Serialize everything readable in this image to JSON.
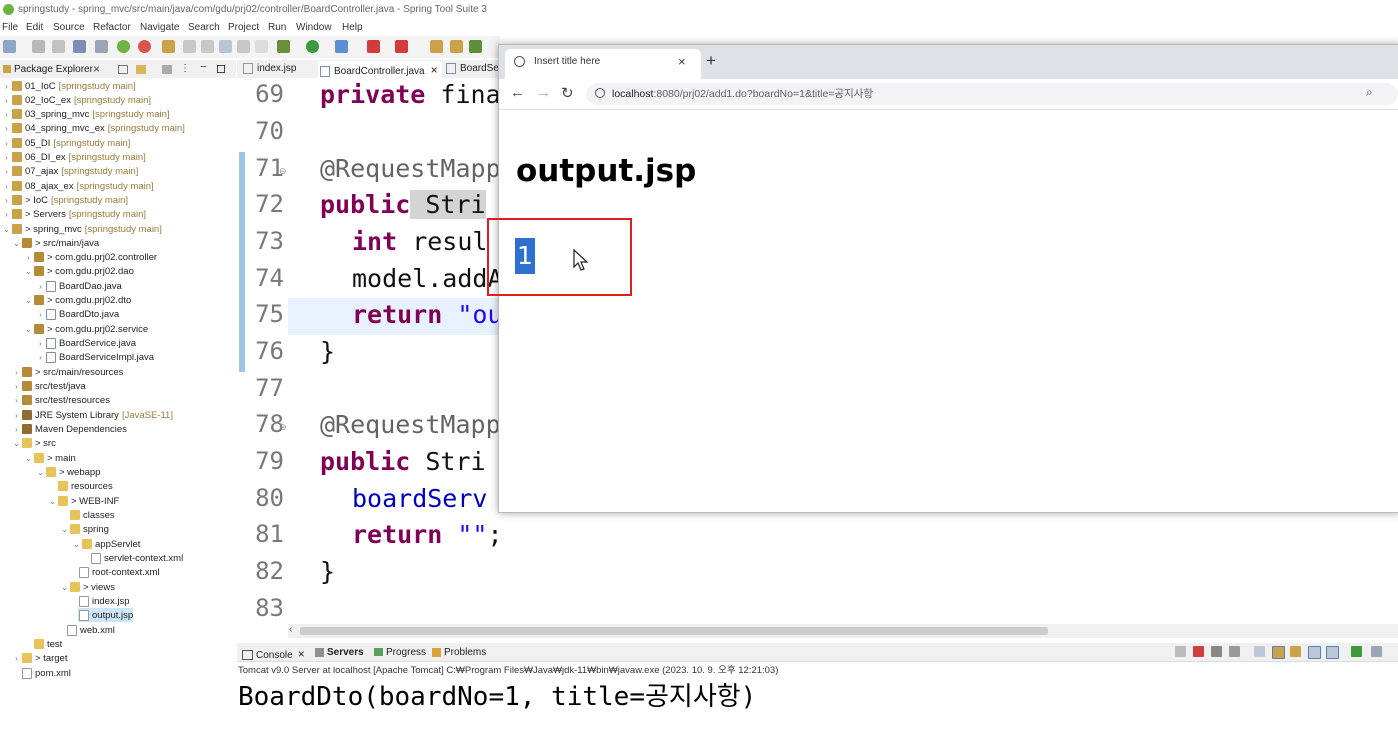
{
  "window": {
    "title": "springstudy - spring_mvc/src/main/java/com/gdu/prj02/controller/BoardController.java - Spring Tool Suite 3"
  },
  "menu": [
    "File",
    "Edit",
    "Source",
    "Refactor",
    "Navigate",
    "Search",
    "Project",
    "Run",
    "Window",
    "Help"
  ],
  "package_explorer": {
    "title": "Package Explorer",
    "items": [
      {
        "label": "01_IoC",
        "sec": "[springstudy main]"
      },
      {
        "label": "02_IoC_ex",
        "sec": "[springstudy main]"
      },
      {
        "label": "03_spring_mvc",
        "sec": "[springstudy main]"
      },
      {
        "label": "04_spring_mvc_ex",
        "sec": "[springstudy main]"
      },
      {
        "label": "05_DI",
        "sec": "[springstudy main]"
      },
      {
        "label": "06_DI_ex",
        "sec": "[springstudy main]"
      },
      {
        "label": "07_ajax",
        "sec": "[springstudy main]"
      },
      {
        "label": "08_ajax_ex",
        "sec": "[springstudy main]"
      },
      {
        "label": "> IoC",
        "sec": "[springstudy main]"
      },
      {
        "label": "> Servers",
        "sec": "[springstudy main]"
      },
      {
        "label": "> spring_mvc",
        "sec": "[springstudy main]"
      },
      {
        "label": "> src/main/java",
        "sec": ""
      },
      {
        "label": "> com.gdu.prj02.controller",
        "sec": ""
      },
      {
        "label": "> com.gdu.prj02.dao",
        "sec": ""
      },
      {
        "label": "BoardDao.java",
        "sec": ""
      },
      {
        "label": "> com.gdu.prj02.dto",
        "sec": ""
      },
      {
        "label": "BoardDto.java",
        "sec": ""
      },
      {
        "label": "> com.gdu.prj02.service",
        "sec": ""
      },
      {
        "label": "BoardService.java",
        "sec": ""
      },
      {
        "label": "BoardServiceImpl.java",
        "sec": ""
      },
      {
        "label": "> src/main/resources",
        "sec": ""
      },
      {
        "label": "src/test/java",
        "sec": ""
      },
      {
        "label": "src/test/resources",
        "sec": ""
      },
      {
        "label": "JRE System Library",
        "sec": "[JavaSE-11]"
      },
      {
        "label": "Maven Dependencies",
        "sec": ""
      },
      {
        "label": "> src",
        "sec": ""
      },
      {
        "label": "> main",
        "sec": ""
      },
      {
        "label": "> webapp",
        "sec": ""
      },
      {
        "label": "resources",
        "sec": ""
      },
      {
        "label": "> WEB-INF",
        "sec": ""
      },
      {
        "label": "classes",
        "sec": ""
      },
      {
        "label": "spring",
        "sec": ""
      },
      {
        "label": "appServlet",
        "sec": ""
      },
      {
        "label": "servlet-context.xml",
        "sec": ""
      },
      {
        "label": "root-context.xml",
        "sec": ""
      },
      {
        "label": "> views",
        "sec": ""
      },
      {
        "label": "index.jsp",
        "sec": ""
      },
      {
        "label": "output.jsp",
        "sec": ""
      },
      {
        "label": "web.xml",
        "sec": ""
      },
      {
        "label": "test",
        "sec": ""
      },
      {
        "label": "> target",
        "sec": ""
      },
      {
        "label": "pom.xml",
        "sec": ""
      }
    ]
  },
  "editor_tabs": [
    "index.jsp",
    "BoardController.java",
    "BoardSer"
  ],
  "editor": {
    "line_numbers": [
      "69",
      "70",
      "71",
      "72",
      "73",
      "74",
      "75",
      "76",
      "77",
      "78",
      "79",
      "80",
      "81",
      "82",
      "83"
    ],
    "l69_kw": "private",
    "l69_rest": " fina",
    "l71": "@RequestMapp",
    "l72_kw": "public",
    "l72_rest": " Stri",
    "l73_kw": "int",
    "l73_rest": " resul",
    "l74": "model.addA",
    "l75_kw": "return",
    "l75_str": " \"ou",
    "l76": "}",
    "l78": "@RequestMapp",
    "l79_kw": "public",
    "l79_rest": " Stri",
    "l80": "boardServ",
    "l81_kw": "return",
    "l81_str": " \"\"",
    "l81_end": ";",
    "l82": "}"
  },
  "console": {
    "tabs": [
      "Console",
      "Servers",
      "Progress",
      "Problems"
    ],
    "subtitle": "Tomcat v9.0 Server at localhost [Apache Tomcat] C:₩Program Files₩Java₩jdk-11₩bin₩javaw.exe  (2023. 10. 9. 오후 12:21:03)",
    "output": "BoardDto(boardNo=1, title=공지사항)"
  },
  "browser": {
    "tab_title": "Insert title here",
    "url_host": "localhost",
    "url_path": ":8080/prj02/add1.do?boardNo=1&title=공지사항",
    "page_heading": "output.jsp",
    "page_value": "1"
  },
  "colors": {
    "highlight_box": "#e01e1e",
    "selection": "#2e6fd2",
    "keyword": "#7f0055",
    "string": "#2a00ff"
  }
}
